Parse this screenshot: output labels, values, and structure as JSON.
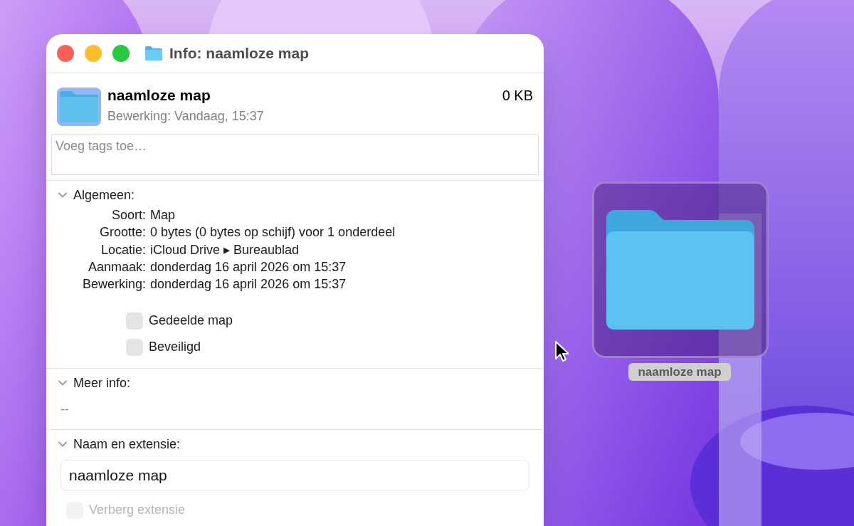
{
  "window": {
    "title": "Info: naamloze map"
  },
  "header": {
    "name": "naamloze map",
    "size": "0 KB",
    "modified": "Bewerking: Vandaag, 15:37"
  },
  "tags": {
    "placeholder": "Voeg tags toe…"
  },
  "sections": [
    {
      "kind": "general",
      "title": "Algemeen:",
      "expanded": true,
      "fields": [
        {
          "label": "Soort:",
          "value": "Map"
        },
        {
          "label": "Grootte:",
          "value": "0 bytes (0 bytes op schijf) voor 1 onderdeel"
        },
        {
          "label": "Locatie:",
          "value": "iCloud Drive ▸ Bureaublad"
        },
        {
          "label": "Aanmaak:",
          "value": "donderdag 16 april 2026 om 15:37"
        },
        {
          "label": "Bewerking:",
          "value": "donderdag 16 april 2026 om 15:37"
        }
      ],
      "checkboxes": [
        {
          "label": "Gedeelde map",
          "checked": false,
          "disabled": false
        },
        {
          "label": "Beveiligd",
          "checked": false,
          "disabled": false
        }
      ]
    },
    {
      "kind": "info",
      "title": "Meer info:",
      "expanded": true,
      "text": "--"
    },
    {
      "kind": "name",
      "title": "Naam en extensie:",
      "expanded": true,
      "value": "naamloze map",
      "checkboxes": [
        {
          "label": "Verberg extensie",
          "checked": false,
          "disabled": true
        }
      ]
    }
  ],
  "desktop_icon": {
    "label": "naamloze map",
    "selected": true
  }
}
